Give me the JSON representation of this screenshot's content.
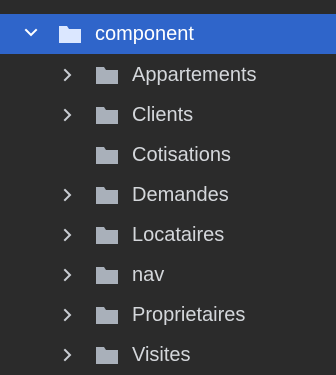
{
  "tree": {
    "root": {
      "label": "component",
      "expanded": true,
      "selected": true,
      "icon": "folder-icon",
      "toggle_icon": "chevron-down-icon"
    },
    "children": [
      {
        "label": "Appartements",
        "has_children": true,
        "icon": "folder-icon",
        "toggle_icon": "chevron-right-icon"
      },
      {
        "label": "Clients",
        "has_children": true,
        "icon": "folder-icon",
        "toggle_icon": "chevron-right-icon"
      },
      {
        "label": "Cotisations",
        "has_children": false,
        "icon": "folder-icon"
      },
      {
        "label": "Demandes",
        "has_children": true,
        "icon": "folder-icon",
        "toggle_icon": "chevron-right-icon"
      },
      {
        "label": "Locataires",
        "has_children": true,
        "icon": "folder-icon",
        "toggle_icon": "chevron-right-icon"
      },
      {
        "label": "nav",
        "has_children": true,
        "icon": "folder-icon",
        "toggle_icon": "chevron-right-icon"
      },
      {
        "label": "Proprietaires",
        "has_children": true,
        "icon": "folder-icon",
        "toggle_icon": "chevron-right-icon"
      },
      {
        "label": "Visites",
        "has_children": true,
        "icon": "folder-icon",
        "toggle_icon": "chevron-right-icon"
      }
    ]
  },
  "colors": {
    "background": "#2b2b2b",
    "selection": "#2f65ca",
    "text": "#d4d7db",
    "selected_text": "#ffffff",
    "folder": "#a9b0ba",
    "selected_folder": "#dbe7ff",
    "chevron": "#c9cdd3",
    "selected_chevron": "#ffffff"
  }
}
